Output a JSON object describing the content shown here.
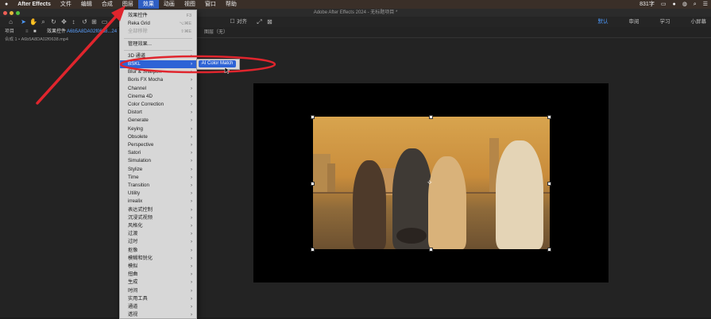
{
  "menubar": {
    "apple": "",
    "app": "After Effects",
    "items": [
      "文件",
      "编辑",
      "合成",
      "图层",
      "效果",
      "动画",
      "视图",
      "窗口",
      "帮助"
    ],
    "active_index": 4,
    "status": "831字"
  },
  "window": {
    "title": "Adobe After Effects 2024 - 无标题项目 *"
  },
  "toolbar": {
    "snap_label": "对齐"
  },
  "workspaces": {
    "items": [
      "默认",
      "审阅",
      "学习",
      "小屏幕"
    ],
    "active_index": 0
  },
  "project_panel": {
    "title": "项目",
    "effects_tab": "效果控件",
    "effects_file": "A6b5A8DA02f0638...24",
    "comp_label": "合成 1 • A6b5A8DA02f0638.mp4"
  },
  "viewer": {
    "layer_label": "图层（无）"
  },
  "menu": {
    "items": [
      {
        "label": "效果控件",
        "shortcut": "F3",
        "disabled": false
      },
      {
        "label": "Reka Grid",
        "shortcut": "⌥⌘E",
        "disabled": false
      },
      {
        "label": "全部移除",
        "shortcut": "⇧⌘E",
        "disabled": true
      },
      {
        "sep": true
      },
      {
        "label": "管理效果...",
        "disabled": false
      },
      {
        "sep": true
      },
      {
        "label": "3D 通道",
        "submenu": true
      },
      {
        "label": "BSKL",
        "submenu": true,
        "highlight": true
      },
      {
        "label": "Blur & Sharpen",
        "submenu": true
      },
      {
        "label": "Boris FX Mocha",
        "submenu": true
      },
      {
        "label": "Channel",
        "submenu": true
      },
      {
        "label": "Cinema 4D",
        "submenu": true
      },
      {
        "label": "Color Correction",
        "submenu": true
      },
      {
        "label": "Distort",
        "submenu": true
      },
      {
        "label": "Generate",
        "submenu": true
      },
      {
        "label": "Keying",
        "submenu": true
      },
      {
        "label": "Obsolete",
        "submenu": true
      },
      {
        "label": "Perspective",
        "submenu": true
      },
      {
        "label": "Satori",
        "submenu": true
      },
      {
        "label": "Simulation",
        "submenu": true
      },
      {
        "label": "Stylize",
        "submenu": true
      },
      {
        "label": "Time",
        "submenu": true
      },
      {
        "label": "Transition",
        "submenu": true
      },
      {
        "label": "Utility",
        "submenu": true
      },
      {
        "label": "irrealix",
        "submenu": true
      },
      {
        "label": "表达式控制",
        "submenu": true
      },
      {
        "label": "沉浸式视频",
        "submenu": true
      },
      {
        "label": "风格化",
        "submenu": true
      },
      {
        "label": "过渡",
        "submenu": true
      },
      {
        "label": "过时",
        "submenu": true
      },
      {
        "label": "抠像",
        "submenu": true
      },
      {
        "label": "模糊和锐化",
        "submenu": true
      },
      {
        "label": "模拟",
        "submenu": true
      },
      {
        "label": "扭曲",
        "submenu": true
      },
      {
        "label": "生成",
        "submenu": true
      },
      {
        "label": "时间",
        "submenu": true
      },
      {
        "label": "实用工具",
        "submenu": true
      },
      {
        "label": "通道",
        "submenu": true
      },
      {
        "label": "透视",
        "submenu": true
      }
    ]
  },
  "submenu": {
    "item": "AI Color Match"
  },
  "colors": {
    "accent": "#2e63d6",
    "annotation": "#e0252d"
  }
}
